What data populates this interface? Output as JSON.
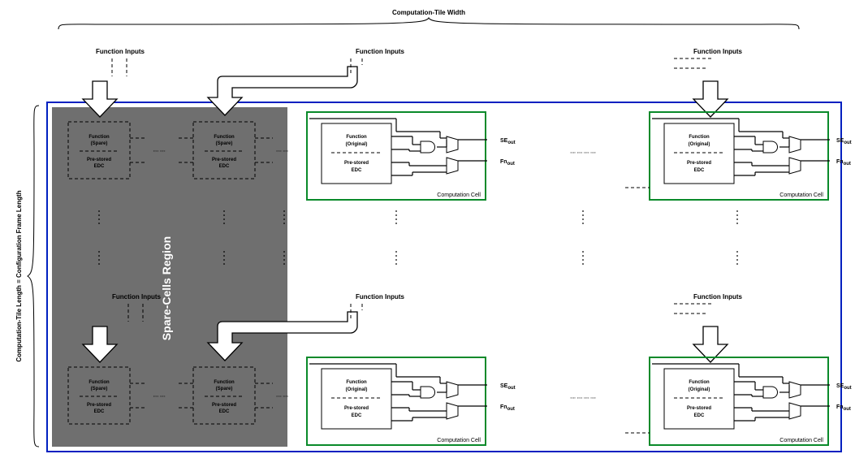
{
  "labels": {
    "tile_width": "Computation-Tile Width",
    "tile_length": "Computation-Tile Length = Configuration Frame Length",
    "function_inputs": "Function Inputs",
    "spare_region": "Spare-Cells Region",
    "computation_cell": "Computation Cell",
    "func_orig_top": "Function",
    "func_orig_bot": "(Original)",
    "func_spare_top": "Function",
    "func_spare_bot": "(Spare)",
    "prestored": "Pre-stored",
    "edc": "EDC",
    "se_out_base": "SE",
    "se_out_sub": "out",
    "fn_out_base": "Fn",
    "fn_out_sub": "out",
    "dots_long": "∙∙∙∙   ∙∙∙∙   ∙∙∙∙   ∙∙∙∙",
    "dots_med": "∙∙∙∙   ∙∙∙∙",
    "vdots": "⸮"
  }
}
